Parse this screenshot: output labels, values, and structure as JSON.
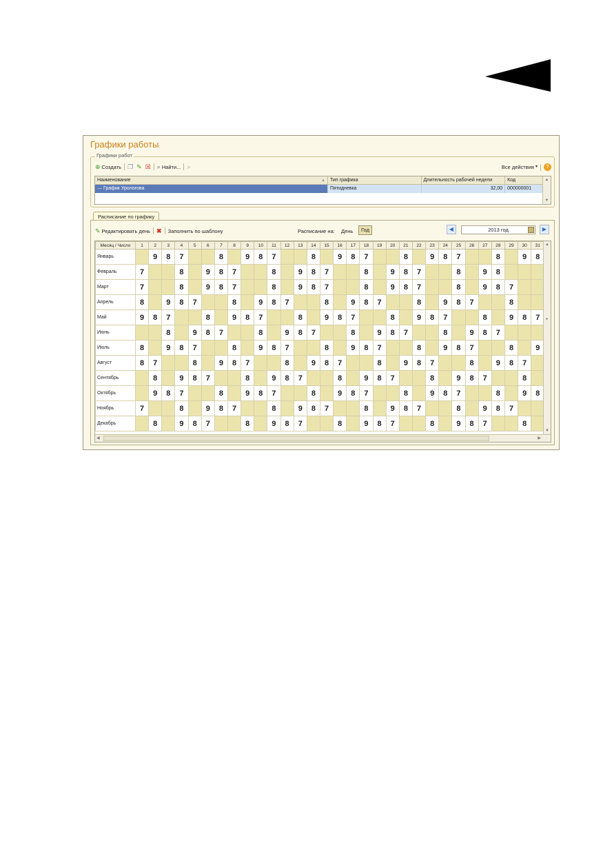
{
  "window": {
    "title": "Графики работы"
  },
  "schedules_group": {
    "legend": "Графики работ",
    "toolbar": {
      "create_label": "Создать",
      "find_label": "Найти...",
      "all_actions_label": "Все действия",
      "help_label": "?"
    },
    "columns": [
      "Наименование",
      "Тип графика",
      "Длительность рабочей недели",
      "Код"
    ],
    "row": {
      "name": "График Урологова",
      "type": "Пятидневка",
      "week_length": "32,00",
      "code": "000000001"
    }
  },
  "tab": {
    "label": "Расписание по графику",
    "toolbar": {
      "edit_day_label": "Редактировать день",
      "fill_by_template_label": "Заполнить по шаблону",
      "schedule_on_label": "Расписание на:",
      "day_label": "День",
      "year_label": "Год",
      "year_value": "2013 год"
    },
    "header_first": "Месяц / Число",
    "days": [
      "1",
      "2",
      "3",
      "4",
      "5",
      "6",
      "7",
      "8",
      "9",
      "10",
      "11",
      "12",
      "13",
      "14",
      "15",
      "16",
      "17",
      "18",
      "19",
      "20",
      "21",
      "22",
      "23",
      "24",
      "25",
      "26",
      "27",
      "28",
      "29",
      "30",
      "31"
    ],
    "months": [
      {
        "name": "Январь",
        "cells": [
          "",
          "9",
          "8",
          "7",
          "",
          "",
          "8",
          "",
          "9",
          "8",
          "7",
          "",
          "",
          "8",
          "",
          "9",
          "8",
          "7",
          "",
          "",
          "8",
          "",
          "9",
          "8",
          "7",
          "",
          "",
          "8",
          "",
          "9",
          "8"
        ]
      },
      {
        "name": "Февраль",
        "cells": [
          "7",
          "",
          "",
          "8",
          "",
          "9",
          "8",
          "7",
          "",
          "",
          "8",
          "",
          "9",
          "8",
          "7",
          "",
          "",
          "8",
          "",
          "9",
          "8",
          "7",
          "",
          "",
          "8",
          "",
          "9",
          "8",
          "",
          "",
          ""
        ]
      },
      {
        "name": "Март",
        "cells": [
          "7",
          "",
          "",
          "8",
          "",
          "9",
          "8",
          "7",
          "",
          "",
          "8",
          "",
          "9",
          "8",
          "7",
          "",
          "",
          "8",
          "",
          "9",
          "8",
          "7",
          "",
          "",
          "8",
          "",
          "9",
          "8",
          "7",
          "",
          ""
        ]
      },
      {
        "name": "Апрель",
        "cells": [
          "8",
          "",
          "9",
          "8",
          "7",
          "",
          "",
          "8",
          "",
          "9",
          "8",
          "7",
          "",
          "",
          "8",
          "",
          "9",
          "8",
          "7",
          "",
          "",
          "8",
          "",
          "9",
          "8",
          "7",
          "",
          "",
          "8",
          "",
          ""
        ]
      },
      {
        "name": "Май",
        "cells": [
          "9",
          "8",
          "7",
          "",
          "",
          "8",
          "",
          "9",
          "8",
          "7",
          "",
          "",
          "8",
          "",
          "9",
          "8",
          "7",
          "",
          "",
          "8",
          "",
          "9",
          "8",
          "7",
          "",
          "",
          "8",
          "",
          "9",
          "8",
          "7"
        ]
      },
      {
        "name": "Июнь",
        "cells": [
          "",
          "",
          "8",
          "",
          "9",
          "8",
          "7",
          "",
          "",
          "8",
          "",
          "9",
          "8",
          "7",
          "",
          "",
          "8",
          "",
          "9",
          "8",
          "7",
          "",
          "",
          "8",
          "",
          "9",
          "8",
          "7",
          "",
          "",
          ""
        ]
      },
      {
        "name": "Июль",
        "cells": [
          "8",
          "",
          "9",
          "8",
          "7",
          "",
          "",
          "8",
          "",
          "9",
          "8",
          "7",
          "",
          "",
          "8",
          "",
          "9",
          "8",
          "7",
          "",
          "",
          "8",
          "",
          "9",
          "8",
          "7",
          "",
          "",
          "8",
          "",
          "9"
        ]
      },
      {
        "name": "Август",
        "cells": [
          "8",
          "7",
          "",
          "",
          "8",
          "",
          "9",
          "8",
          "7",
          "",
          "",
          "8",
          "",
          "9",
          "8",
          "7",
          "",
          "",
          "8",
          "",
          "9",
          "8",
          "7",
          "",
          "",
          "8",
          "",
          "9",
          "8",
          "7",
          ""
        ]
      },
      {
        "name": "Сентябрь",
        "cells": [
          "",
          "8",
          "",
          "9",
          "8",
          "7",
          "",
          "",
          "8",
          "",
          "9",
          "8",
          "7",
          "",
          "",
          "8",
          "",
          "9",
          "8",
          "7",
          "",
          "",
          "8",
          "",
          "9",
          "8",
          "7",
          "",
          "",
          "8",
          ""
        ]
      },
      {
        "name": "Октябрь",
        "cells": [
          "",
          "9",
          "8",
          "7",
          "",
          "",
          "8",
          "",
          "9",
          "8",
          "7",
          "",
          "",
          "8",
          "",
          "9",
          "8",
          "7",
          "",
          "",
          "8",
          "",
          "9",
          "8",
          "7",
          "",
          "",
          "8",
          "",
          "9",
          "8"
        ]
      },
      {
        "name": "Ноябрь",
        "cells": [
          "7",
          "",
          "",
          "8",
          "",
          "9",
          "8",
          "7",
          "",
          "",
          "8",
          "",
          "9",
          "8",
          "7",
          "",
          "",
          "8",
          "",
          "9",
          "8",
          "7",
          "",
          "",
          "8",
          "",
          "9",
          "8",
          "7",
          "",
          ""
        ]
      },
      {
        "name": "Декабрь",
        "cells": [
          "",
          "8",
          "",
          "9",
          "8",
          "7",
          "",
          "",
          "8",
          "",
          "9",
          "8",
          "7",
          "",
          "",
          "8",
          "",
          "9",
          "8",
          "7",
          "",
          "",
          "8",
          "",
          "9",
          "8",
          "7",
          "",
          "",
          "8",
          ""
        ]
      }
    ]
  },
  "colors": {
    "title": "#c9821a",
    "off_day": "#ebe4ad",
    "selection": "#5b7ab8"
  }
}
